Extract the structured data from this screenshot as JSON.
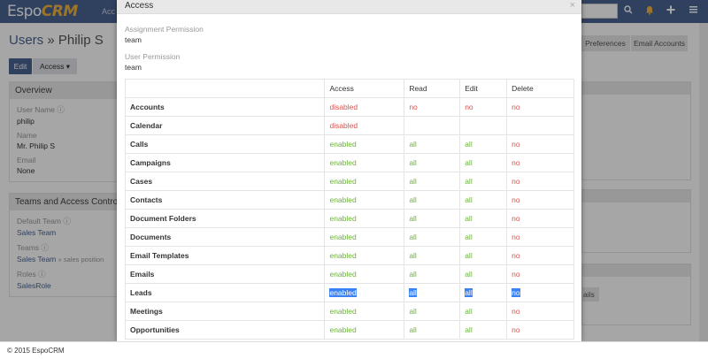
{
  "navbar": {
    "logo_main": "Espo",
    "logo_crm": "CRM",
    "tab_fragment": "Acc",
    "search_icon": "search-icon",
    "bell_icon": "bell-icon",
    "plus_icon": "plus-icon",
    "menu_icon": "menu-icon"
  },
  "page": {
    "breadcrumb": "Users",
    "separator": "»",
    "name": "Philip S",
    "edit_label": "Edit",
    "access_label": "Access",
    "preferences_label": "Preferences",
    "email_accounts_label": "Email Accounts"
  },
  "overview": {
    "title": "Overview",
    "username_label": "User Name",
    "username_value": "philip",
    "name_label": "Name",
    "name_value": "Mr. Philip S",
    "email_label": "Email",
    "email_value": "None"
  },
  "teams": {
    "title": "Teams and Access Control",
    "default_team_label": "Default Team",
    "default_team_value": "Sales Team",
    "teams_label": "Teams",
    "teams_value": "Sales Team",
    "teams_position": "» sales position",
    "roles_label": "Roles",
    "roles_value": "SalesRole"
  },
  "right_panel": {
    "fragment": "ails"
  },
  "modal": {
    "title": "Access",
    "close": "×",
    "assignment_label": "Assignment Permission",
    "assignment_value": "team",
    "user_perm_label": "User Permission",
    "user_perm_value": "team",
    "columns": [
      "",
      "Access",
      "Read",
      "Edit",
      "Delete"
    ],
    "rows": [
      {
        "scope": "Accounts",
        "access": "disabled",
        "read": "no",
        "edit": "no",
        "delete": "no"
      },
      {
        "scope": "Calendar",
        "access": "disabled",
        "read": "",
        "edit": "",
        "delete": ""
      },
      {
        "scope": "Calls",
        "access": "enabled",
        "read": "all",
        "edit": "all",
        "delete": "no"
      },
      {
        "scope": "Campaigns",
        "access": "enabled",
        "read": "all",
        "edit": "all",
        "delete": "no"
      },
      {
        "scope": "Cases",
        "access": "enabled",
        "read": "all",
        "edit": "all",
        "delete": "no"
      },
      {
        "scope": "Contacts",
        "access": "enabled",
        "read": "all",
        "edit": "all",
        "delete": "no"
      },
      {
        "scope": "Document Folders",
        "access": "enabled",
        "read": "all",
        "edit": "all",
        "delete": "no"
      },
      {
        "scope": "Documents",
        "access": "enabled",
        "read": "all",
        "edit": "all",
        "delete": "no"
      },
      {
        "scope": "Email Templates",
        "access": "enabled",
        "read": "all",
        "edit": "all",
        "delete": "no"
      },
      {
        "scope": "Emails",
        "access": "enabled",
        "read": "all",
        "edit": "all",
        "delete": "no"
      },
      {
        "scope": "Leads",
        "access": "enabled",
        "read": "all",
        "edit": "all",
        "delete": "no",
        "selected": true
      },
      {
        "scope": "Meetings",
        "access": "enabled",
        "read": "all",
        "edit": "all",
        "delete": "no"
      },
      {
        "scope": "Opportunities",
        "access": "enabled",
        "read": "all",
        "edit": "all",
        "delete": "no"
      }
    ]
  },
  "footer": {
    "text": "© 2015 EspoCRM"
  },
  "colors": {
    "navbar": "#4a6492",
    "enabled": "#6cb23a",
    "disabled": "#d9534f",
    "selection": "#3b82f6"
  }
}
